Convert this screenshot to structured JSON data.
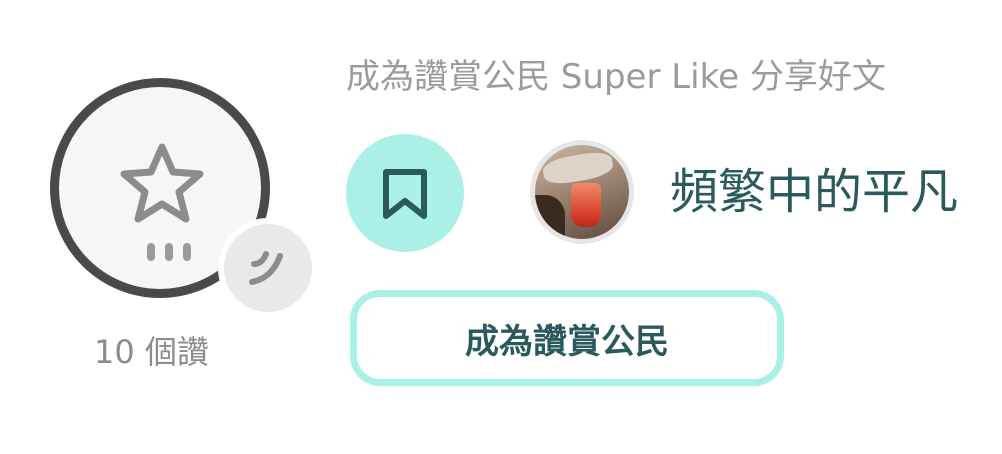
{
  "like": {
    "count_label": "10 個讚"
  },
  "super_like": {
    "caption": "成為讚賞公民 Super Like 分享好文"
  },
  "author": {
    "name": "頻繁中的平凡"
  },
  "patron_button": {
    "label": "成為讚賞公民"
  },
  "colors": {
    "accent_mint": "#aaf0e6",
    "text_teal": "#2b5a5e",
    "ring_dark": "#4a4a4a",
    "muted_text": "#9b9b9b"
  },
  "icons": {
    "like": "star-icon",
    "clap": "clap-icon",
    "bookmark": "bookmark-icon"
  }
}
